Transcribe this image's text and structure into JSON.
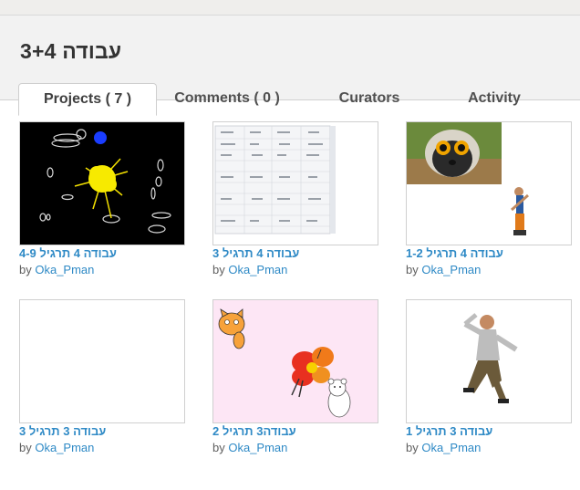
{
  "gallery": {
    "title": "עבודה 3+4"
  },
  "tabs": [
    {
      "label": "Projects ( 7 )",
      "active": true
    },
    {
      "label": "Comments ( 0 )",
      "active": false
    },
    {
      "label": "Curators",
      "active": false
    },
    {
      "label": "Activity",
      "active": false
    }
  ],
  "projects": [
    {
      "title": "עבודה 4 תרגיל 4-9",
      "by_label": "by",
      "author": "Oka_Pman",
      "thumbnail": "black-stage-sun-icon"
    },
    {
      "title": "עבודה 4 תרגיל 3",
      "by_label": "by",
      "author": "Oka_Pman",
      "thumbnail": "spreadsheet-table-icon"
    },
    {
      "title": "עבודה 4 תרגיל 1-2",
      "by_label": "by",
      "author": "Oka_Pman",
      "thumbnail": "lemur-breakdancer-icon"
    },
    {
      "title": "עבודה 3 תרגיל 3",
      "by_label": "by",
      "author": "Oka_Pman",
      "thumbnail": "blank-stage-icon"
    },
    {
      "title": "עבודה3 תרגיל 2",
      "by_label": "by",
      "author": "Oka_Pman",
      "thumbnail": "cat-butterfly-bear-icon"
    },
    {
      "title": "עבודה 3 תרגיל 1",
      "by_label": "by",
      "author": "Oka_Pman",
      "thumbnail": "dancing-man-icon"
    }
  ],
  "colors": {
    "link": "#2f8ac6",
    "header_bg": "#f2f2f2",
    "pink_stage": "#fde6f5"
  }
}
